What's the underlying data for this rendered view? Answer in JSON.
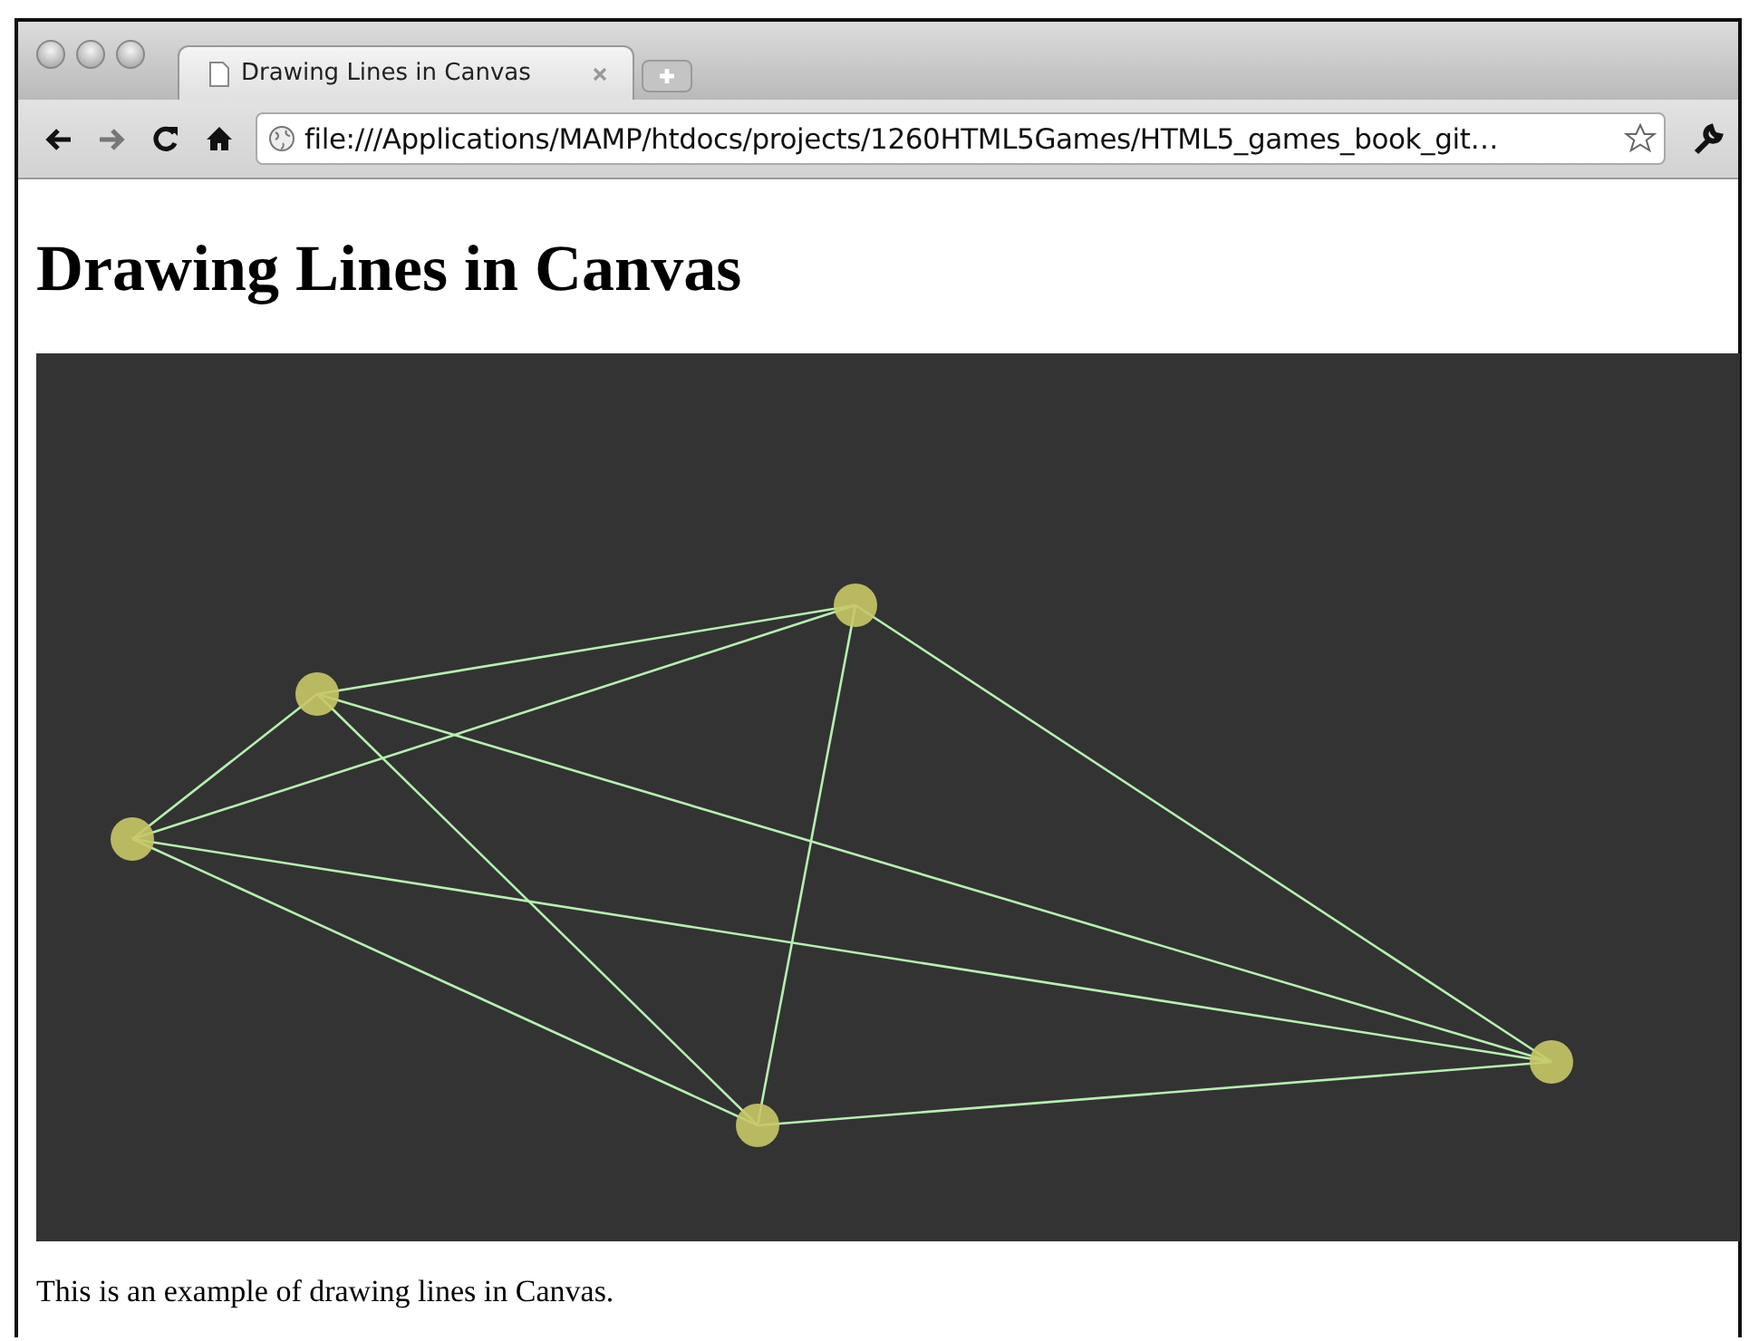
{
  "browser": {
    "tabs": [
      {
        "title": "Drawing Lines in Canvas",
        "selected": true
      }
    ],
    "address": "file:///Applications/MAMP/htdocs/projects/1260HTML5Games/HTML5_games_book_git…"
  },
  "page": {
    "heading": "Drawing Lines in Canvas",
    "caption": "This is an example of drawing lines in Canvas."
  }
}
